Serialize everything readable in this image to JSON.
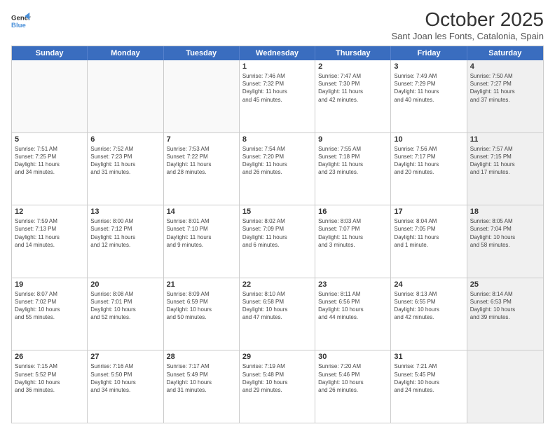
{
  "header": {
    "logo_line1": "General",
    "logo_line2": "Blue",
    "month_title": "October 2025",
    "subtitle": "Sant Joan les Fonts, Catalonia, Spain"
  },
  "day_headers": [
    "Sunday",
    "Monday",
    "Tuesday",
    "Wednesday",
    "Thursday",
    "Friday",
    "Saturday"
  ],
  "weeks": [
    [
      {
        "num": "",
        "info": "",
        "empty": true
      },
      {
        "num": "",
        "info": "",
        "empty": true
      },
      {
        "num": "",
        "info": "",
        "empty": true
      },
      {
        "num": "1",
        "info": "Sunrise: 7:46 AM\nSunset: 7:32 PM\nDaylight: 11 hours\nand 45 minutes.",
        "empty": false
      },
      {
        "num": "2",
        "info": "Sunrise: 7:47 AM\nSunset: 7:30 PM\nDaylight: 11 hours\nand 42 minutes.",
        "empty": false
      },
      {
        "num": "3",
        "info": "Sunrise: 7:49 AM\nSunset: 7:29 PM\nDaylight: 11 hours\nand 40 minutes.",
        "empty": false
      },
      {
        "num": "4",
        "info": "Sunrise: 7:50 AM\nSunset: 7:27 PM\nDaylight: 11 hours\nand 37 minutes.",
        "empty": false,
        "shaded": true
      }
    ],
    [
      {
        "num": "5",
        "info": "Sunrise: 7:51 AM\nSunset: 7:25 PM\nDaylight: 11 hours\nand 34 minutes.",
        "empty": false
      },
      {
        "num": "6",
        "info": "Sunrise: 7:52 AM\nSunset: 7:23 PM\nDaylight: 11 hours\nand 31 minutes.",
        "empty": false
      },
      {
        "num": "7",
        "info": "Sunrise: 7:53 AM\nSunset: 7:22 PM\nDaylight: 11 hours\nand 28 minutes.",
        "empty": false
      },
      {
        "num": "8",
        "info": "Sunrise: 7:54 AM\nSunset: 7:20 PM\nDaylight: 11 hours\nand 26 minutes.",
        "empty": false
      },
      {
        "num": "9",
        "info": "Sunrise: 7:55 AM\nSunset: 7:18 PM\nDaylight: 11 hours\nand 23 minutes.",
        "empty": false
      },
      {
        "num": "10",
        "info": "Sunrise: 7:56 AM\nSunset: 7:17 PM\nDaylight: 11 hours\nand 20 minutes.",
        "empty": false
      },
      {
        "num": "11",
        "info": "Sunrise: 7:57 AM\nSunset: 7:15 PM\nDaylight: 11 hours\nand 17 minutes.",
        "empty": false,
        "shaded": true
      }
    ],
    [
      {
        "num": "12",
        "info": "Sunrise: 7:59 AM\nSunset: 7:13 PM\nDaylight: 11 hours\nand 14 minutes.",
        "empty": false
      },
      {
        "num": "13",
        "info": "Sunrise: 8:00 AM\nSunset: 7:12 PM\nDaylight: 11 hours\nand 12 minutes.",
        "empty": false
      },
      {
        "num": "14",
        "info": "Sunrise: 8:01 AM\nSunset: 7:10 PM\nDaylight: 11 hours\nand 9 minutes.",
        "empty": false
      },
      {
        "num": "15",
        "info": "Sunrise: 8:02 AM\nSunset: 7:09 PM\nDaylight: 11 hours\nand 6 minutes.",
        "empty": false
      },
      {
        "num": "16",
        "info": "Sunrise: 8:03 AM\nSunset: 7:07 PM\nDaylight: 11 hours\nand 3 minutes.",
        "empty": false
      },
      {
        "num": "17",
        "info": "Sunrise: 8:04 AM\nSunset: 7:05 PM\nDaylight: 11 hours\nand 1 minute.",
        "empty": false
      },
      {
        "num": "18",
        "info": "Sunrise: 8:05 AM\nSunset: 7:04 PM\nDaylight: 10 hours\nand 58 minutes.",
        "empty": false,
        "shaded": true
      }
    ],
    [
      {
        "num": "19",
        "info": "Sunrise: 8:07 AM\nSunset: 7:02 PM\nDaylight: 10 hours\nand 55 minutes.",
        "empty": false
      },
      {
        "num": "20",
        "info": "Sunrise: 8:08 AM\nSunset: 7:01 PM\nDaylight: 10 hours\nand 52 minutes.",
        "empty": false
      },
      {
        "num": "21",
        "info": "Sunrise: 8:09 AM\nSunset: 6:59 PM\nDaylight: 10 hours\nand 50 minutes.",
        "empty": false
      },
      {
        "num": "22",
        "info": "Sunrise: 8:10 AM\nSunset: 6:58 PM\nDaylight: 10 hours\nand 47 minutes.",
        "empty": false
      },
      {
        "num": "23",
        "info": "Sunrise: 8:11 AM\nSunset: 6:56 PM\nDaylight: 10 hours\nand 44 minutes.",
        "empty": false
      },
      {
        "num": "24",
        "info": "Sunrise: 8:13 AM\nSunset: 6:55 PM\nDaylight: 10 hours\nand 42 minutes.",
        "empty": false
      },
      {
        "num": "25",
        "info": "Sunrise: 8:14 AM\nSunset: 6:53 PM\nDaylight: 10 hours\nand 39 minutes.",
        "empty": false,
        "shaded": true
      }
    ],
    [
      {
        "num": "26",
        "info": "Sunrise: 7:15 AM\nSunset: 5:52 PM\nDaylight: 10 hours\nand 36 minutes.",
        "empty": false
      },
      {
        "num": "27",
        "info": "Sunrise: 7:16 AM\nSunset: 5:50 PM\nDaylight: 10 hours\nand 34 minutes.",
        "empty": false
      },
      {
        "num": "28",
        "info": "Sunrise: 7:17 AM\nSunset: 5:49 PM\nDaylight: 10 hours\nand 31 minutes.",
        "empty": false
      },
      {
        "num": "29",
        "info": "Sunrise: 7:19 AM\nSunset: 5:48 PM\nDaylight: 10 hours\nand 29 minutes.",
        "empty": false
      },
      {
        "num": "30",
        "info": "Sunrise: 7:20 AM\nSunset: 5:46 PM\nDaylight: 10 hours\nand 26 minutes.",
        "empty": false
      },
      {
        "num": "31",
        "info": "Sunrise: 7:21 AM\nSunset: 5:45 PM\nDaylight: 10 hours\nand 24 minutes.",
        "empty": false
      },
      {
        "num": "",
        "info": "",
        "empty": true,
        "shaded": true
      }
    ]
  ]
}
